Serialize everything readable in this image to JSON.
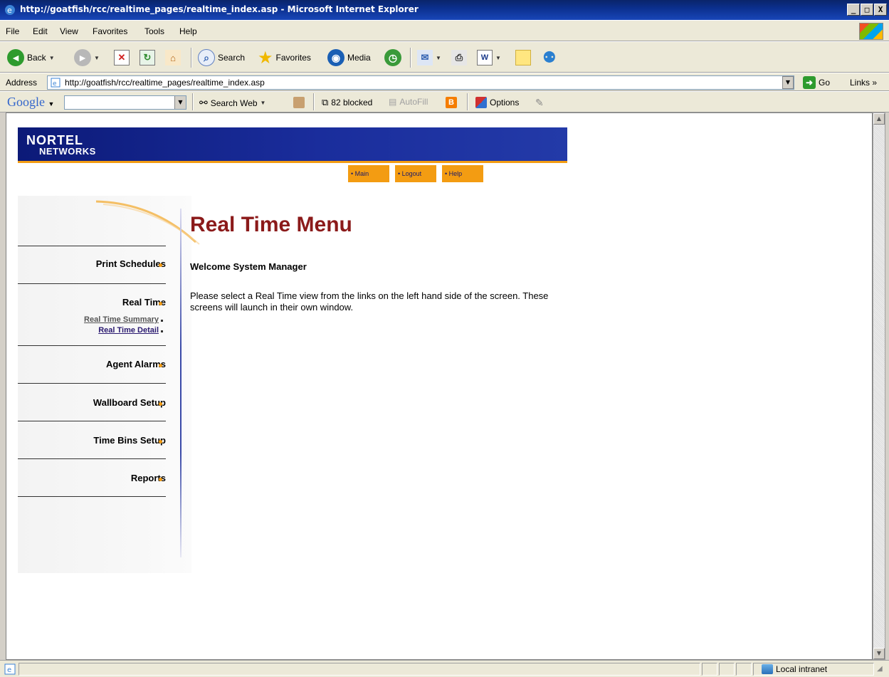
{
  "window": {
    "title": "http://goatfish/rcc/realtime_pages/realtime_index.asp - Microsoft Internet Explorer",
    "minimize": "_",
    "maximize": "□",
    "close": "X"
  },
  "menubar": {
    "items": [
      "File",
      "Edit",
      "View",
      "Favorites",
      "Tools",
      "Help"
    ]
  },
  "toolbar": {
    "back_label": "Back",
    "search_label": "Search",
    "favorites_label": "Favorites",
    "media_label": "Media"
  },
  "addressbar": {
    "label": "Address",
    "url": "http://goatfish/rcc/realtime_pages/realtime_index.asp",
    "go_label": "Go",
    "links_label": "Links »"
  },
  "googlebar": {
    "logo": "Google",
    "search_web": "Search Web",
    "blocked": "82 blocked",
    "autofill": "AutoFill",
    "options": "Options"
  },
  "page": {
    "logo_line1": "NORTEL",
    "logo_line2": "NETWORKS",
    "top_nav": [
      "• Main",
      "• Logout",
      "• Help"
    ],
    "title": "Real Time Menu",
    "welcome": "Welcome System Manager",
    "instructions": "Please select a Real Time view from the links on the left hand side of the screen. These screens will launch in their own window.",
    "left_nav": {
      "print_schedules": "Print Schedules",
      "real_time": "Real Time",
      "real_time_summary": "Real Time Summary",
      "real_time_detail": "Real Time Detail",
      "agent_alarms": "Agent Alarms",
      "wallboard_setup": "Wallboard Setup",
      "time_bins_setup": "Time Bins Setup",
      "reports": "Reports"
    }
  },
  "statusbar": {
    "zone": "Local intranet"
  },
  "colors": {
    "title_red": "#8b1a1a",
    "accent_orange": "#f39c12",
    "banner_blue": "#1a2d9c"
  }
}
